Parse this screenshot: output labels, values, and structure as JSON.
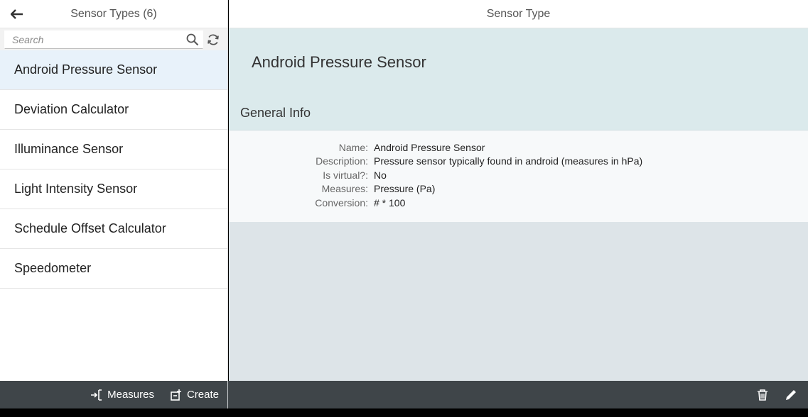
{
  "master": {
    "title": "Sensor Types (6)",
    "search_placeholder": "Search",
    "items": [
      {
        "label": "Android Pressure Sensor"
      },
      {
        "label": "Deviation Calculator"
      },
      {
        "label": "Illuminance Sensor"
      },
      {
        "label": "Light Intensity Sensor"
      },
      {
        "label": "Schedule Offset Calculator"
      },
      {
        "label": "Speedometer"
      }
    ],
    "selected_index": 0
  },
  "detail": {
    "header_title": "Sensor Type",
    "object_title": "Android Pressure Sensor",
    "section_title": "General Info",
    "fields": [
      {
        "label": "Name:",
        "value": "Android Pressure Sensor"
      },
      {
        "label": "Description:",
        "value": "Pressure sensor typically found in android (measures in hPa)"
      },
      {
        "label": "Is virtual?:",
        "value": "No"
      },
      {
        "label": "Measures:",
        "value": "Pressure (Pa)"
      },
      {
        "label": "Conversion:",
        "value": "# * 100"
      }
    ]
  },
  "footer": {
    "measures_label": "Measures",
    "create_label": "Create",
    "icons": [
      "measures-icon",
      "create-icon",
      "delete-icon",
      "edit-icon"
    ]
  },
  "colors": {
    "selected_item_bg": "#e8f2fa",
    "object_header_bg": "#dbeaec",
    "footer_bg": "#3f4549"
  }
}
